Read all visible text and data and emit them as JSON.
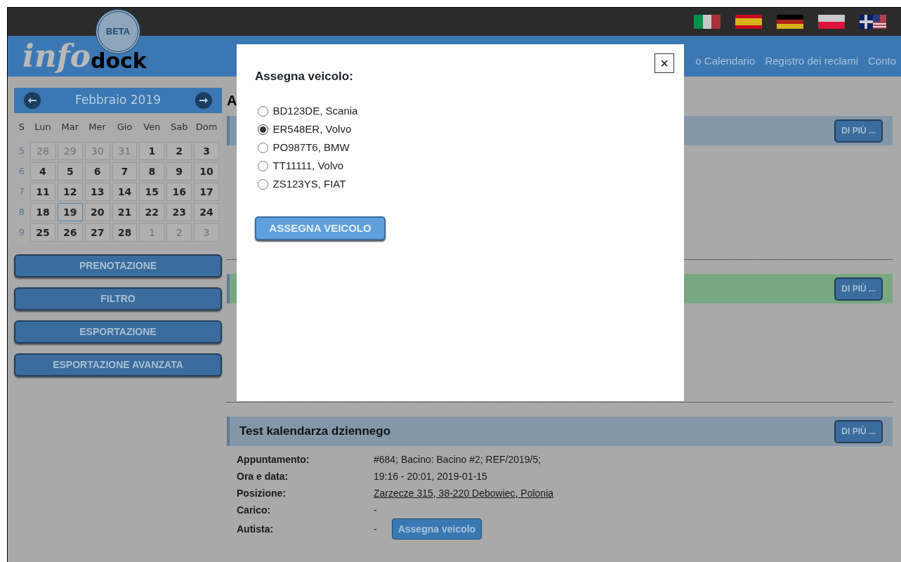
{
  "header": {
    "stamp": "BETA",
    "logo_left": "info",
    "logo_right": "dock",
    "nav": [
      "o Calendario",
      "Registro dei reclami",
      "Conto"
    ],
    "flags": [
      {
        "color": "#009246"
      },
      {
        "color": "#c60b1e"
      },
      {
        "color": "#000000"
      },
      {
        "color": "#dc143c"
      },
      {
        "color": "#012169"
      }
    ]
  },
  "calendar": {
    "title": "Febbraio 2019",
    "week_label": "S",
    "weekdays": [
      "Lun",
      "Mar",
      "Mer",
      "Gio",
      "Ven",
      "Sab",
      "Dom"
    ],
    "weeks": [
      {
        "number": "5",
        "days": [
          {
            "label": "28",
            "other_month": true,
            "selected": false
          },
          {
            "label": "29",
            "other_month": true,
            "selected": false
          },
          {
            "label": "30",
            "other_month": true,
            "selected": false
          },
          {
            "label": "31",
            "other_month": true,
            "selected": false
          },
          {
            "label": "1",
            "other_month": false,
            "selected": false
          },
          {
            "label": "2",
            "other_month": false,
            "selected": false
          },
          {
            "label": "3",
            "other_month": false,
            "selected": false
          }
        ]
      },
      {
        "number": "6",
        "days": [
          {
            "label": "4",
            "other_month": false,
            "selected": false
          },
          {
            "label": "5",
            "other_month": false,
            "selected": false
          },
          {
            "label": "6",
            "other_month": false,
            "selected": false
          },
          {
            "label": "7",
            "other_month": false,
            "selected": false
          },
          {
            "label": "8",
            "other_month": false,
            "selected": false
          },
          {
            "label": "9",
            "other_month": false,
            "selected": false
          },
          {
            "label": "10",
            "other_month": false,
            "selected": false
          }
        ]
      },
      {
        "number": "7",
        "days": [
          {
            "label": "11",
            "other_month": false,
            "selected": false
          },
          {
            "label": "12",
            "other_month": false,
            "selected": false
          },
          {
            "label": "13",
            "other_month": false,
            "selected": false
          },
          {
            "label": "14",
            "other_month": false,
            "selected": false
          },
          {
            "label": "15",
            "other_month": false,
            "selected": false
          },
          {
            "label": "16",
            "other_month": false,
            "selected": false
          },
          {
            "label": "17",
            "other_month": false,
            "selected": false
          }
        ]
      },
      {
        "number": "8",
        "days": [
          {
            "label": "18",
            "other_month": false,
            "selected": false
          },
          {
            "label": "19",
            "other_month": false,
            "selected": true
          },
          {
            "label": "20",
            "other_month": false,
            "selected": false
          },
          {
            "label": "21",
            "other_month": false,
            "selected": false
          },
          {
            "label": "22",
            "other_month": false,
            "selected": false
          },
          {
            "label": "23",
            "other_month": false,
            "selected": false
          },
          {
            "label": "24",
            "other_month": false,
            "selected": false
          }
        ]
      },
      {
        "number": "9",
        "days": [
          {
            "label": "25",
            "other_month": false,
            "selected": false
          },
          {
            "label": "26",
            "other_month": false,
            "selected": false
          },
          {
            "label": "27",
            "other_month": false,
            "selected": false
          },
          {
            "label": "28",
            "other_month": false,
            "selected": false
          },
          {
            "label": "1",
            "other_month": true,
            "selected": false
          },
          {
            "label": "2",
            "other_month": true,
            "selected": false
          },
          {
            "label": "3",
            "other_month": true,
            "selected": false
          }
        ]
      }
    ]
  },
  "sidebar_buttons": [
    "PRENOTAZIONE",
    "FILTRO",
    "ESPORTAZIONE",
    "ESPORTAZIONE AVANZATA"
  ],
  "main": {
    "heading": "A",
    "sections": [
      {
        "color": "#8497a8",
        "button": "DI PIÙ ..."
      },
      {
        "color": "#78a882",
        "button": "DI PIÙ ..."
      },
      {
        "color": "#8497a8",
        "button": "DI PIÙ ...",
        "title": "Test kalendarza dziennego",
        "details": [
          {
            "label": "Appuntamento:",
            "value": "#684; Bacino: Bacino #2; REF/2019/5;"
          },
          {
            "label": "Ora e data:",
            "value": "19:16 - 20:01, 2019-01-15"
          },
          {
            "label": "Posizione:",
            "value": "Zarzecze 315, 38-220 Debowiec, Polonia",
            "kind": "link"
          },
          {
            "label": "Carico:",
            "value": "-"
          },
          {
            "label": "Autista:",
            "value": "-",
            "action": "Assegna veicolo"
          }
        ]
      }
    ]
  },
  "modal": {
    "title": "Assegna veicolo:",
    "close": "×",
    "options": [
      {
        "label": "BD123DE, Scania",
        "selected": false
      },
      {
        "label": "ER548ER, Volvo",
        "selected": true
      },
      {
        "label": "PO987T6, BMW",
        "selected": false
      },
      {
        "label": "TT11111, Volvo",
        "selected": false
      },
      {
        "label": "ZS123YS, FIAT",
        "selected": false
      }
    ],
    "button": "ASSEGNA VEICOLO"
  }
}
